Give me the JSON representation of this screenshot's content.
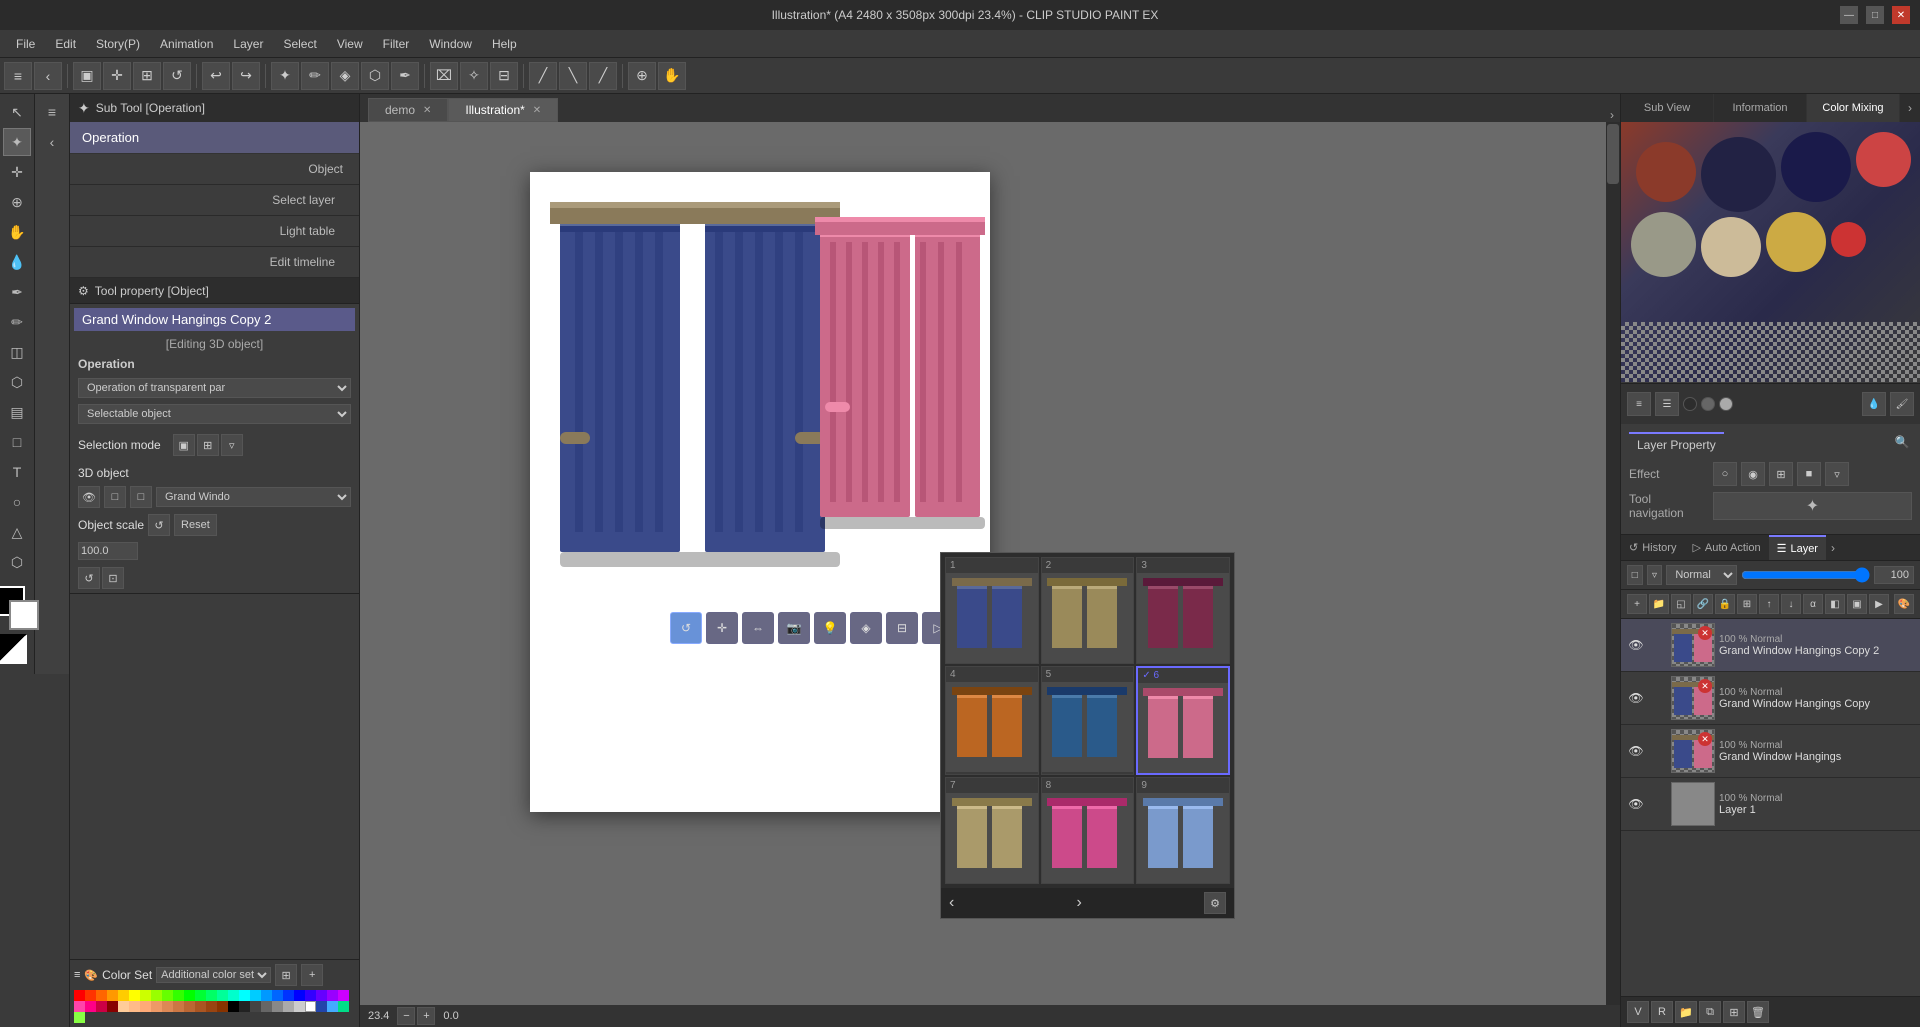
{
  "titlebar": {
    "title": "Illustration* (A4 2480 x 3508px 300dpi 23.4%)  - CLIP STUDIO PAINT EX",
    "win_min": "—",
    "win_max": "□",
    "win_close": "✕"
  },
  "menubar": {
    "items": [
      "File",
      "Edit",
      "Story(P)",
      "Animation",
      "Layer",
      "Select",
      "View",
      "Filter",
      "Window",
      "Help"
    ]
  },
  "subtool": {
    "header": "Sub Tool [Operation]",
    "items": [
      {
        "label": "Operation",
        "active": true
      },
      {
        "label": "Object"
      },
      {
        "label": "Select layer"
      },
      {
        "label": "Light table"
      },
      {
        "label": "Edit timeline"
      }
    ]
  },
  "tool_property": {
    "header": "Tool property [Object]",
    "layer_name": "Grand Window Hangings Copy 2",
    "editing": "[Editing 3D object]",
    "operation_label": "Operation",
    "operation_value": "Operation of transparent par",
    "selectable_label": "",
    "selectable_value": "Selectable object",
    "selection_mode_label": "Selection mode",
    "object_label": "3D object",
    "object_value": "Grand Windo",
    "scale_label": "Object scale",
    "scale_reset": "Reset"
  },
  "color_set": {
    "header": "Color Set",
    "additional": "Additional color set"
  },
  "canvas": {
    "tabs": [
      {
        "label": "demo",
        "active": false
      },
      {
        "label": "Illustration*",
        "active": true
      }
    ]
  },
  "material_picker": {
    "cells": [
      {
        "num": "1",
        "selected": false,
        "color_top": "#3a4a7a",
        "color_mid": "#5a6aaa",
        "color_bot": "#2a3a6a"
      },
      {
        "num": "2",
        "selected": false,
        "color_top": "#8a7a5a",
        "color_mid": "#aa9a7a",
        "color_bot": "#6a5a3a"
      },
      {
        "num": "3",
        "selected": false,
        "color_top": "#8a3a5a",
        "color_mid": "#aa5a7a",
        "color_bot": "#6a2a4a"
      },
      {
        "num": "4",
        "selected": false,
        "color_top": "#aa6a2a",
        "color_mid": "#cc8a4a",
        "color_bot": "#8a4a1a"
      },
      {
        "num": "5",
        "selected": false,
        "color_top": "#2a5a8a",
        "color_mid": "#4a7aaa",
        "color_bot": "#1a3a6a"
      },
      {
        "num": "6",
        "selected": true,
        "color_top": "#cc6a8a",
        "color_mid": "#ee8aaa",
        "color_bot": "#aa4a6a"
      },
      {
        "num": "7",
        "selected": false,
        "color_top": "#aa9a6a",
        "color_mid": "#ccba8a",
        "color_bot": "#8a7a4a"
      },
      {
        "num": "8",
        "selected": false,
        "color_top": "#cc4a8a",
        "color_mid": "#ee6aaa",
        "color_bot": "#aa2a6a"
      },
      {
        "num": "9",
        "selected": false,
        "color_top": "#7a9acc",
        "color_mid": "#9abaee",
        "color_bot": "#5a7aaa"
      }
    ]
  },
  "right_panel": {
    "tabs": [
      "Sub View",
      "Information",
      "Color Mixing"
    ],
    "active_tab": "Color Mixing"
  },
  "color_circles": [
    {
      "color": "#8B3A2A",
      "size": 55
    },
    {
      "color": "#222244",
      "size": 70
    },
    {
      "color": "#1a1a4a",
      "size": 65
    },
    {
      "color": "#cc4444",
      "size": 45
    },
    {
      "color": "#999988",
      "size": 60
    },
    {
      "color": "#ccbb99",
      "size": 55
    },
    {
      "color": "#ccaa44",
      "size": 55
    },
    {
      "color": "#cc3333",
      "size": 30
    }
  ],
  "layer_property": {
    "effect_label": "Effect",
    "tool_nav_label": "Tool navigation"
  },
  "layers": {
    "tabs": [
      "History",
      "Auto Action",
      "Layer"
    ],
    "active_tab": "Layer",
    "blend_mode": "Normal",
    "opacity": "100",
    "items": [
      {
        "visible": true,
        "blend": "100 % Normal",
        "name": "Grand Window Hangings Copy 2",
        "active": true,
        "has_x": true
      },
      {
        "visible": true,
        "blend": "100 % Normal",
        "name": "Grand Window Hangings Copy",
        "active": false,
        "has_x": true
      },
      {
        "visible": true,
        "blend": "100 % Normal",
        "name": "Grand Window Hangings",
        "active": false,
        "has_x": true
      },
      {
        "visible": true,
        "blend": "100 % Normal",
        "name": "Layer 1",
        "active": false,
        "has_x": false
      }
    ]
  },
  "statusbar": {
    "zoom": "23.4",
    "coords": "0.0"
  }
}
